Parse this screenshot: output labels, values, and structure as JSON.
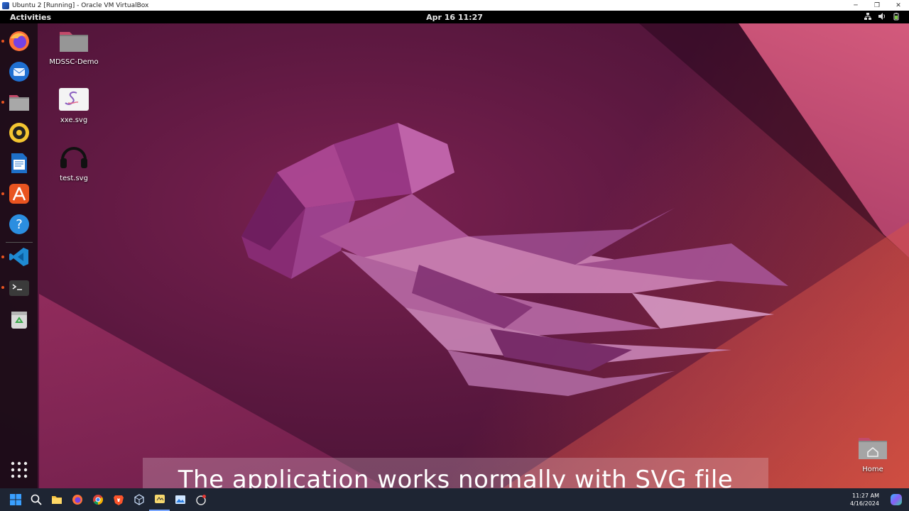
{
  "window": {
    "title": "Ubuntu 2 [Running] - Oracle VM VirtualBox",
    "controls": {
      "minimize": "─",
      "restore": "❐",
      "close": "✕"
    }
  },
  "topbar": {
    "activities": "Activities",
    "clock": "Apr 16  11:27",
    "tray_icons": [
      "network-icon",
      "volume-icon",
      "battery-icon"
    ]
  },
  "dock": {
    "items": [
      {
        "name": "firefox",
        "icon": "firefox-icon",
        "running": true
      },
      {
        "name": "thunderbird",
        "icon": "thunderbird-icon",
        "running": false
      },
      {
        "name": "files",
        "icon": "files-icon",
        "running": true
      },
      {
        "name": "rhythmbox",
        "icon": "rhythmbox-icon",
        "running": false
      },
      {
        "name": "libreoffice-writer",
        "icon": "writer-icon",
        "running": false
      },
      {
        "name": "app-center",
        "icon": "app-center-icon",
        "running": true
      },
      {
        "name": "help",
        "icon": "help-icon",
        "running": false
      },
      {
        "name": "vscode",
        "icon": "vscode-icon",
        "running": true
      },
      {
        "name": "terminal",
        "icon": "terminal-icon",
        "running": true
      },
      {
        "name": "trash",
        "icon": "trash-icon",
        "running": false
      }
    ],
    "show_apps": "show-apps-icon"
  },
  "desktop": {
    "icons": [
      {
        "label": "MDSSC-Demo",
        "icon": "folder-icon"
      },
      {
        "label": "xxe.svg",
        "icon": "svg-file-icon"
      },
      {
        "label": "test.svg",
        "icon": "headphones-svg-icon"
      }
    ],
    "home": {
      "label": "Home",
      "icon": "home-folder-icon"
    }
  },
  "subtitle": "The application works normally with SVG file",
  "taskbar": {
    "time": "11:27 AM",
    "date": "4/16/2024",
    "apps": [
      "start-icon",
      "search-icon",
      "file-explorer-icon",
      "firefox-icon",
      "chrome-icon",
      "brave-icon",
      "virtualbox-icon",
      "app-icon",
      "photos-icon",
      "app-icon-2"
    ]
  },
  "colors": {
    "ubuntu_orange": "#e95420",
    "topbar": "#000000",
    "taskbar": "#1e2533"
  }
}
